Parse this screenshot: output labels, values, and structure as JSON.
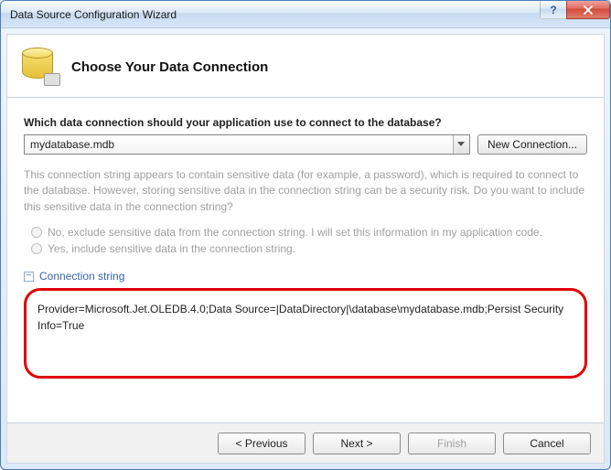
{
  "window": {
    "title": "Data Source Configuration Wizard"
  },
  "header": {
    "title": "Choose Your Data Connection"
  },
  "body": {
    "prompt": "Which data connection should your application use to connect to the database?",
    "selected_connection": "mydatabase.mdb",
    "new_connection_label": "New Connection...",
    "sensitive_desc": "This connection string appears to contain sensitive data (for example, a password), which is required to connect to the database. However, storing sensitive data in the connection string can be a security risk. Do you want to include this sensitive data in the connection string?",
    "radio_no": "No, exclude sensitive data from the connection string. I will set this information in my application code.",
    "radio_yes": "Yes, include sensitive data in the connection string.",
    "conn_label": "Connection string",
    "conn_string": "Provider=Microsoft.Jet.OLEDB.4.0;Data Source=|DataDirectory|\\database\\mydatabase.mdb;Persist Security Info=True"
  },
  "footer": {
    "previous": "< Previous",
    "next": "Next >",
    "finish": "Finish",
    "cancel": "Cancel"
  }
}
